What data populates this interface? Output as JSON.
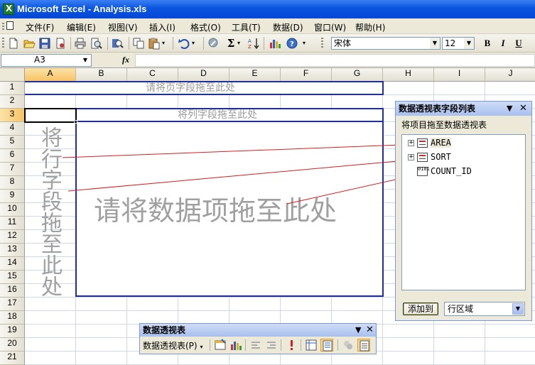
{
  "window": {
    "title": "Microsoft Excel - Analysis.xls"
  },
  "menu": [
    "文件(F)",
    "编辑(E)",
    "视图(V)",
    "插入(I)",
    "格式(O)",
    "工具(T)",
    "数据(D)",
    "窗口(W)",
    "帮助(H)"
  ],
  "toolbar": {
    "icons": [
      "new-icon",
      "open-icon",
      "save-icon",
      "permission-icon",
      "print-icon",
      "print-preview-icon",
      "research-icon",
      "copy-icon",
      "paste-icon",
      "undo-icon",
      "hyperlink-icon",
      "autosum-icon",
      "sort-ascending-icon",
      "chart-wizard-icon",
      "help-icon"
    ],
    "autosum_label": "Σ",
    "font_name": "宋体",
    "font_size": "12",
    "bold_label": "B",
    "italic_label": "I",
    "underline_label": "U"
  },
  "formula_bar": {
    "name_box": "A3",
    "fx_label": "fx",
    "value": ""
  },
  "sheet": {
    "columns": [
      "A",
      "B",
      "C",
      "D",
      "E",
      "F",
      "G",
      "H",
      "I",
      "J"
    ],
    "rows": [
      "1",
      "2",
      "3",
      "4",
      "5",
      "6",
      "7",
      "8",
      "9",
      "10",
      "11",
      "12",
      "13",
      "14",
      "15",
      "16",
      "17",
      "18",
      "19",
      "20",
      "21"
    ],
    "active_cell": "A3"
  },
  "pivot": {
    "page_area_label": "请将页字段拖至此处",
    "column_area_label": "将列字段拖至此处",
    "row_area_label": "将行字段拖至此处",
    "data_area_label": "请将数据项拖至此处"
  },
  "field_list": {
    "title": "数据透视表字段列表",
    "subtitle": "将项目拖至数据透视表",
    "fields": [
      "AREA",
      "SORT",
      "COUNT_ID"
    ],
    "add_button": "添加到",
    "target_area": "行区域"
  },
  "pivot_toolbar": {
    "title": "数据透视表",
    "menu_label": "数据透视表(P)",
    "icons": [
      "format-report-icon",
      "pivot-chart-icon",
      "hide-detail-icon",
      "show-detail-icon",
      "refresh-data-icon",
      "field-settings-icon",
      "show-field-list-icon",
      "include-hidden-items-icon",
      "always-display-items-icon"
    ]
  },
  "colors": {
    "pivot_border": "#1f2e9a",
    "title_bar": "#0a55e0",
    "connector": "#d02020"
  }
}
